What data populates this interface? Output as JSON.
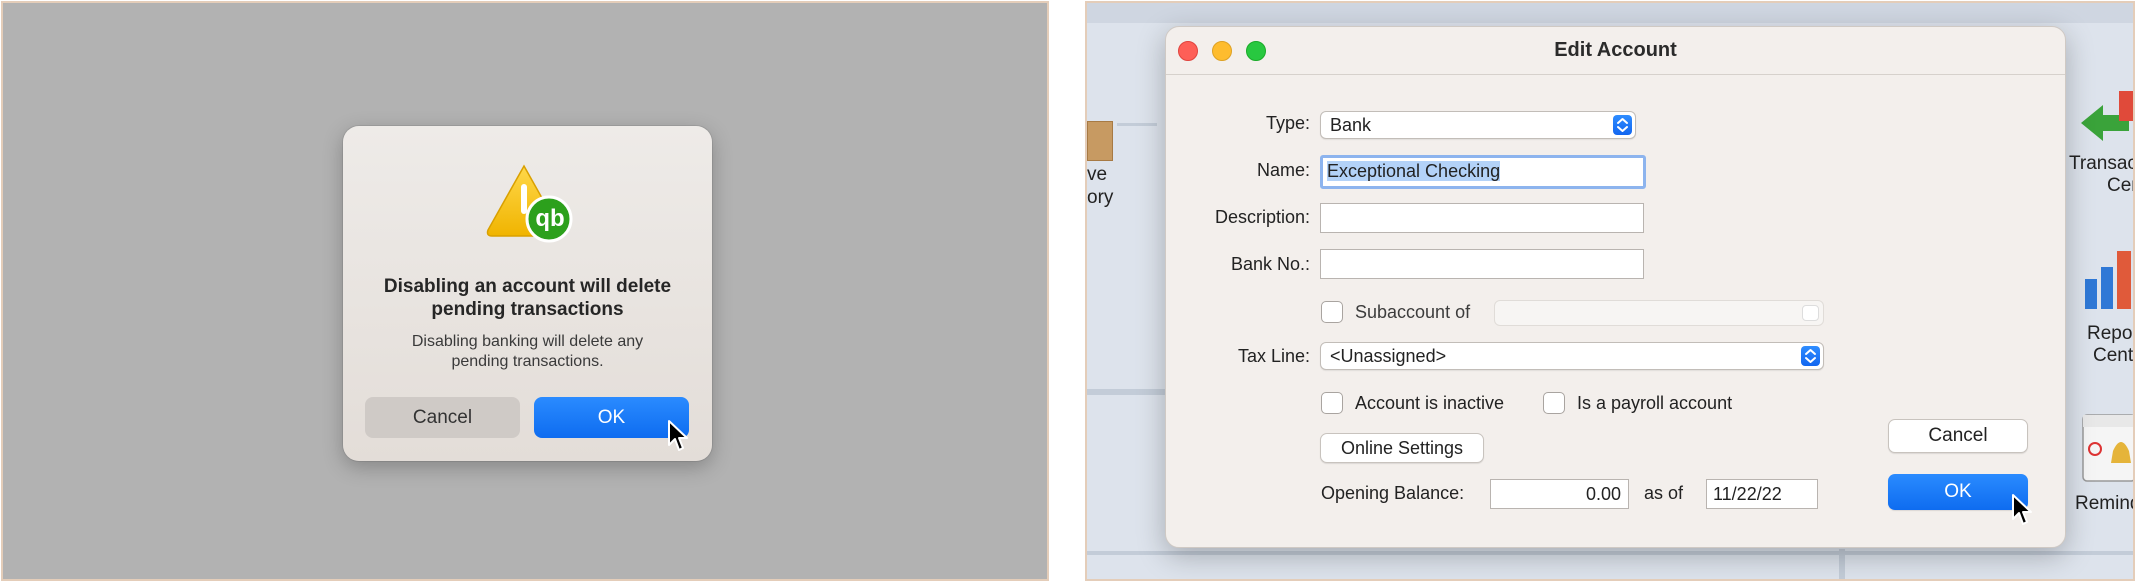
{
  "alert": {
    "title": "Disabling an account will delete pending transactions",
    "message": "Disabling banking will delete any pending transactions.",
    "cancel_label": "Cancel",
    "ok_label": "OK",
    "badge_text": "qb",
    "icon": "warning-icon"
  },
  "background": {
    "left_label_line1": "ve",
    "left_label_line2": "ory",
    "right_labels": [
      "Transac",
      "Cente",
      "Repo",
      "Cent",
      "Remind"
    ]
  },
  "dialog": {
    "title": "Edit Account",
    "type_label": "Type:",
    "type_value": "Bank",
    "name_label": "Name:",
    "name_value": "Exceptional Checking",
    "description_label": "Description:",
    "description_value": "",
    "bank_no_label": "Bank No.:",
    "bank_no_value": "",
    "subaccount_label": "Subaccount of",
    "tax_line_label": "Tax Line:",
    "tax_line_value": "<Unassigned>",
    "inactive_label": "Account is inactive",
    "payroll_label": "Is a payroll account",
    "online_settings_label": "Online Settings",
    "opening_balance_label": "Opening Balance:",
    "opening_balance_value": "0.00",
    "as_of_label": "as of",
    "as_of_value": "11/22/22",
    "cancel_label": "Cancel",
    "ok_label": "OK"
  },
  "colors": {
    "accent": "#0e6cf0",
    "close": "#fe5f57",
    "minimize": "#febc2e",
    "maximize": "#28c840",
    "selection": "#b3d2f8"
  }
}
